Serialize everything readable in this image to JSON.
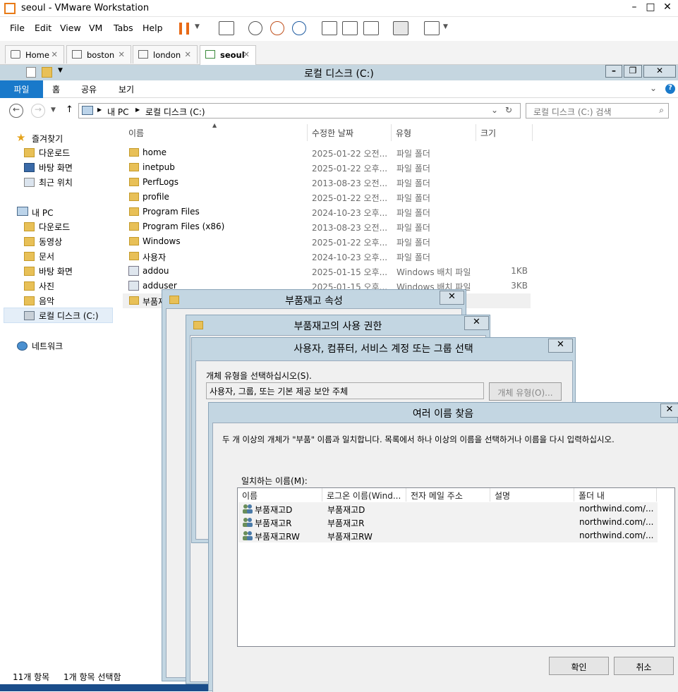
{
  "vmware": {
    "title": "seoul - VMware Workstation",
    "menu": [
      "File",
      "Edit",
      "View",
      "VM",
      "Tabs",
      "Help"
    ],
    "tabs": [
      {
        "label": "Home"
      },
      {
        "label": "boston"
      },
      {
        "label": "london"
      },
      {
        "label": "seoul"
      }
    ]
  },
  "explorer": {
    "title": "로컬 디스크 (C:)",
    "ribbon_tabs": [
      "파일",
      "홈",
      "공유",
      "보기"
    ],
    "breadcrumb": [
      "내 PC",
      "로컬 디스크 (C:)"
    ],
    "search_placeholder": "로컬 디스크 (C:) 검색",
    "nav": {
      "favorites": "즐겨찾기",
      "favorites_items": [
        "다운로드",
        "바탕 화면",
        "최근 위치"
      ],
      "this_pc": "내 PC",
      "this_pc_items": [
        "다운로드",
        "동영상",
        "문서",
        "바탕 화면",
        "사진",
        "음악",
        "로컬 디스크 (C:)"
      ],
      "network": "네트워크"
    },
    "columns": [
      "이름",
      "수정한 날짜",
      "유형",
      "크기"
    ],
    "files": [
      {
        "name": "home",
        "date": "2025-01-22 오전...",
        "type": "파일 폴더",
        "size": "",
        "kind": "folder"
      },
      {
        "name": "inetpub",
        "date": "2025-01-22 오후...",
        "type": "파일 폴더",
        "size": "",
        "kind": "folder"
      },
      {
        "name": "PerfLogs",
        "date": "2013-08-23 오전...",
        "type": "파일 폴더",
        "size": "",
        "kind": "folder"
      },
      {
        "name": "profile",
        "date": "2025-01-22 오전...",
        "type": "파일 폴더",
        "size": "",
        "kind": "folder"
      },
      {
        "name": "Program Files",
        "date": "2024-10-23 오후...",
        "type": "파일 폴더",
        "size": "",
        "kind": "folder"
      },
      {
        "name": "Program Files (x86)",
        "date": "2013-08-23 오전...",
        "type": "파일 폴더",
        "size": "",
        "kind": "folder"
      },
      {
        "name": "Windows",
        "date": "2025-01-22 오후...",
        "type": "파일 폴더",
        "size": "",
        "kind": "folder"
      },
      {
        "name": "사용자",
        "date": "2024-10-23 오후...",
        "type": "파일 폴더",
        "size": "",
        "kind": "folder"
      },
      {
        "name": "addou",
        "date": "2025-01-15 오후...",
        "type": "Windows 배치 파일",
        "size": "1KB",
        "kind": "bat"
      },
      {
        "name": "adduser",
        "date": "2025-01-15 오후...",
        "type": "Windows 배치 파일",
        "size": "3KB",
        "kind": "bat"
      },
      {
        "name": "부품재고",
        "date": "",
        "type": "",
        "size": "",
        "kind": "folder"
      }
    ],
    "status_items": "11개 항목",
    "status_selected": "1개 항목 선택함"
  },
  "dialogs": {
    "props_title": "부품재고 속성",
    "perm_title": "부품재고의 사용 권한",
    "select_title": "사용자, 컴퓨터, 서비스 계정 또는 그룹 선택",
    "select_obj_label": "개체 유형을 선택하십시오(S).",
    "select_obj_value": "사용자, 그룹, 또는 기본 제공 보안 주체",
    "select_obj_button": "개체 유형(O)...",
    "multi_title": "여러 이름 찾음",
    "multi_desc": "두 개 이상의 개체가 \"부품\" 이름과 일치합니다. 목록에서 하나 이상의 이름을 선택하거나 이름을 다시 입력하십시오.",
    "multi_list_label": "일치하는 이름(M):",
    "multi_columns": [
      "이름",
      "로그온 이름(Wind...",
      "전자 메일 주소",
      "설명",
      "폴더 내"
    ],
    "multi_rows": [
      {
        "name": "부품재고D",
        "logon": "부품재고D",
        "folder": "northwind.com/..."
      },
      {
        "name": "부품재고R",
        "logon": "부품재고R",
        "folder": "northwind.com/..."
      },
      {
        "name": "부품재고RW",
        "logon": "부품재고RW",
        "folder": "northwind.com/..."
      }
    ],
    "ok": "확인",
    "cancel": "취소"
  },
  "colors": {
    "accent": "#1979ca",
    "dialog_frame": "#c3d6e2",
    "vm_pause": "#e86a17"
  }
}
